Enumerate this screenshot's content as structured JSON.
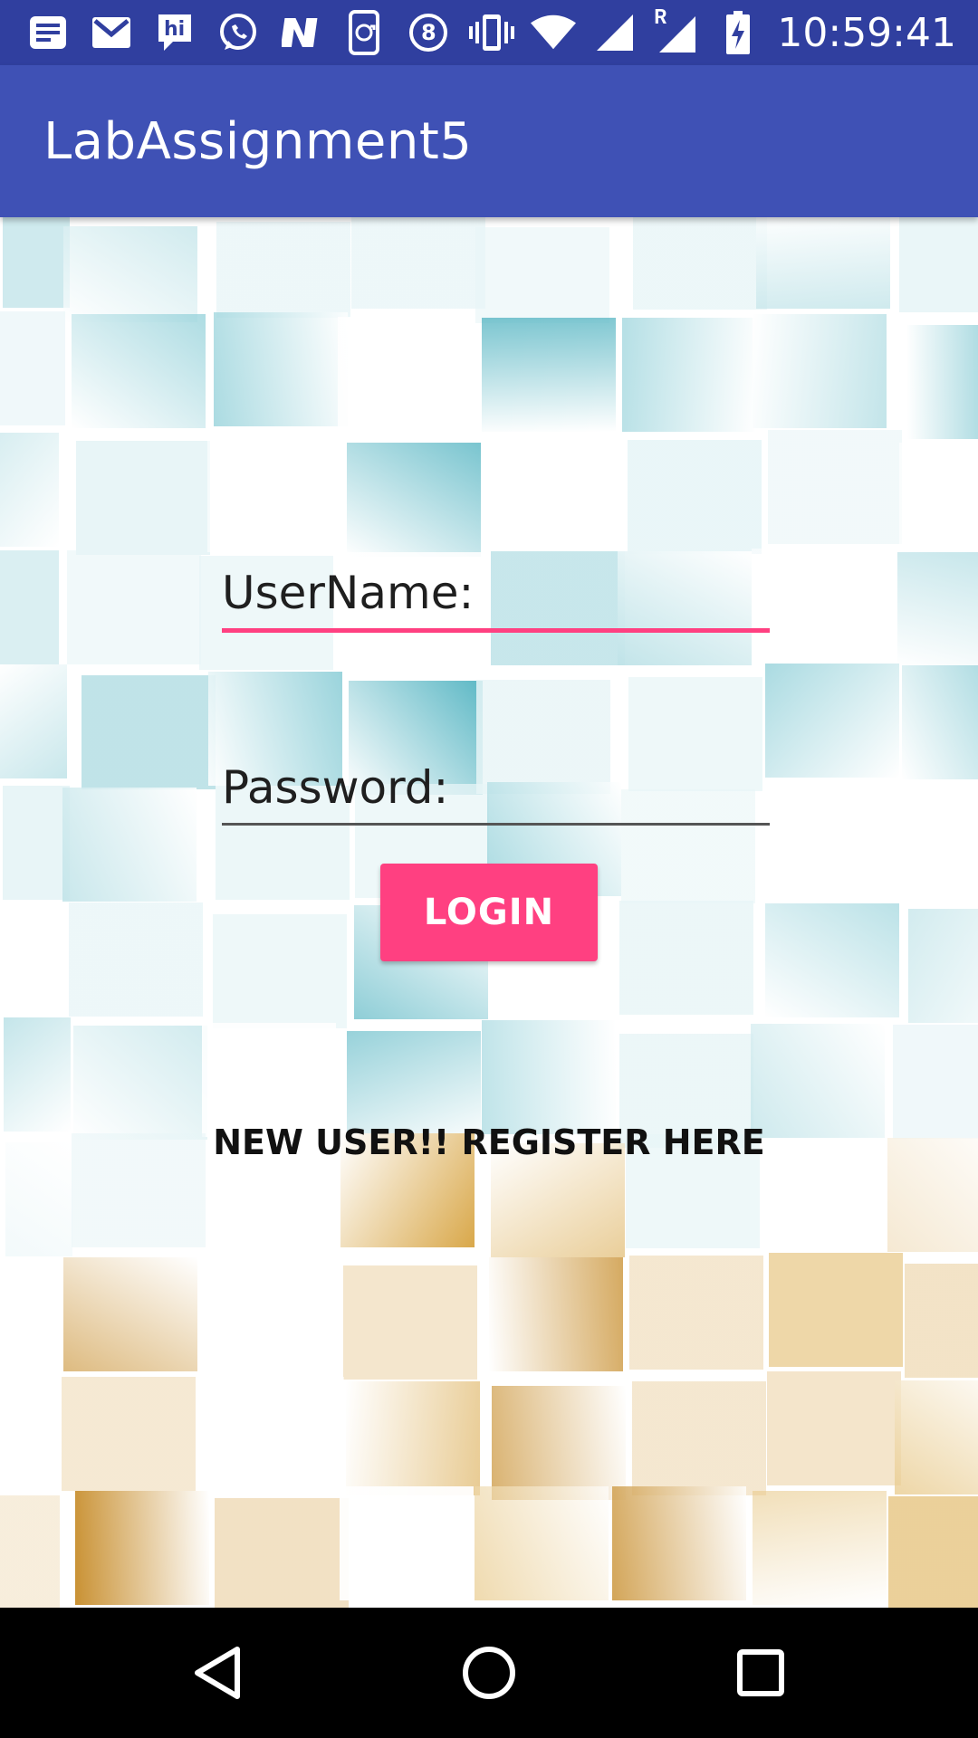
{
  "status_bar": {
    "time": "10:59:41",
    "icons": [
      "notes-icon",
      "gmail-icon",
      "hike-icon",
      "whatsapp-icon",
      "n-app-icon",
      "sync-icon",
      "eight-icon",
      "vibrate-icon",
      "wifi-icon",
      "signal-icon",
      "roaming-signal-icon",
      "battery-charging-icon"
    ],
    "roaming_label": "R"
  },
  "app_bar": {
    "title": "LabAssignment5",
    "color": "#3F51B5"
  },
  "form": {
    "username_placeholder": "UserName:",
    "password_placeholder": "Password:",
    "login_label": "LOGIN",
    "register_label": "NEW USER!! REGISTER HERE"
  },
  "colors": {
    "accent": "#FF4081",
    "primary_dark": "#303F9F"
  },
  "nav_bar": {
    "buttons": [
      "back-icon",
      "home-icon",
      "recents-icon"
    ]
  }
}
